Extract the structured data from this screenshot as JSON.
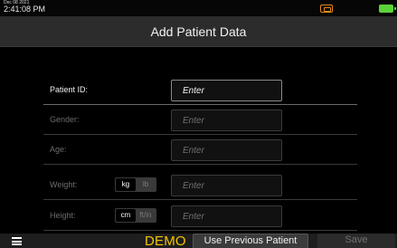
{
  "status": {
    "date": "Dec 08 2021",
    "time": "2:41:08 PM",
    "icons": [
      "warning-icon",
      "battery-icon"
    ],
    "battery_color": "#5bd23a",
    "warning_color": "#e08a1a"
  },
  "header": {
    "title": "Add Patient Data"
  },
  "form": {
    "rows": [
      {
        "label": "Patient ID:",
        "placeholder": "Enter",
        "active": true
      },
      {
        "label": "Gender:",
        "placeholder": "Enter",
        "active": false
      },
      {
        "label": "Age:",
        "placeholder": "Enter",
        "active": false
      },
      {
        "label": "Weight:",
        "placeholder": "Enter",
        "active": false,
        "units": [
          "kg",
          "lb"
        ],
        "selected_unit": "kg"
      },
      {
        "label": "Height:",
        "placeholder": "Enter",
        "active": false,
        "units": [
          "cm",
          "ft/in"
        ],
        "selected_unit": "cm"
      }
    ]
  },
  "footer": {
    "menu_icon": "hamburger-menu-icon",
    "mode_label": "DEMO",
    "mode_color": "#f6c400",
    "use_previous_label": "Use Previous Patient",
    "save_label": "Save"
  }
}
